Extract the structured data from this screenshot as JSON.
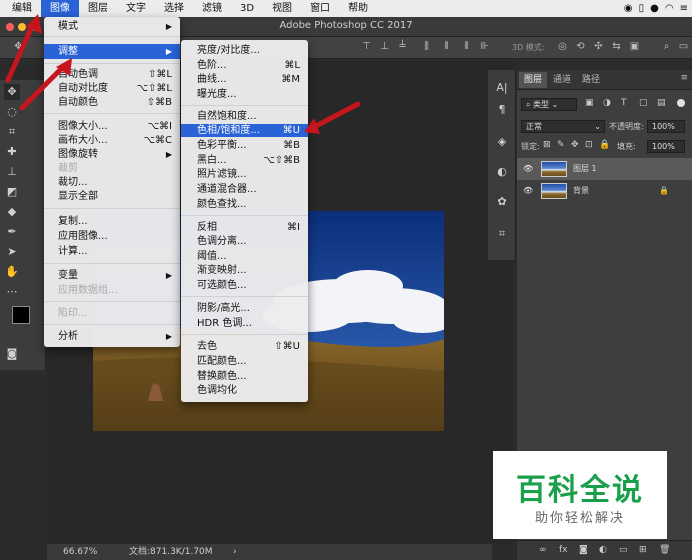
{
  "menubar": {
    "items": [
      "编辑",
      "图像",
      "图层",
      "文字",
      "选择",
      "滤镜",
      "3D",
      "视图",
      "窗口",
      "帮助"
    ],
    "active_index": 1
  },
  "window": {
    "title": "Adobe Photoshop CC 2017"
  },
  "options_bar": {
    "mode_label": "3D 模式:"
  },
  "image_menu": {
    "items": [
      {
        "label": "模式",
        "submenu": true
      },
      {
        "label": "调整",
        "submenu": true,
        "highlighted": true
      },
      {
        "label": "自动色调",
        "shortcut": "⇧⌘L"
      },
      {
        "label": "自动对比度",
        "shortcut": "⌥⇧⌘L"
      },
      {
        "label": "自动颜色",
        "shortcut": "⇧⌘B"
      },
      {
        "label": "图像大小...",
        "shortcut": "⌥⌘I"
      },
      {
        "label": "画布大小...",
        "shortcut": "⌥⌘C"
      },
      {
        "label": "图像旋转",
        "submenu": true
      },
      {
        "label": "裁剪",
        "disabled": true
      },
      {
        "label": "裁切..."
      },
      {
        "label": "显示全部"
      },
      {
        "label": "复制..."
      },
      {
        "label": "应用图像..."
      },
      {
        "label": "计算..."
      },
      {
        "label": "变量",
        "submenu": true
      },
      {
        "label": "应用数据组...",
        "disabled": true
      },
      {
        "label": "陷印...",
        "disabled": true
      },
      {
        "label": "分析",
        "submenu": true
      }
    ]
  },
  "adjust_submenu": {
    "items": [
      {
        "label": "亮度/对比度..."
      },
      {
        "label": "色阶...",
        "shortcut": "⌘L"
      },
      {
        "label": "曲线...",
        "shortcut": "⌘M"
      },
      {
        "label": "曝光度..."
      },
      {
        "label": "自然饱和度..."
      },
      {
        "label": "色相/饱和度...",
        "shortcut": "⌘U",
        "highlighted": true
      },
      {
        "label": "色彩平衡...",
        "shortcut": "⌘B"
      },
      {
        "label": "黑白...",
        "shortcut": "⌥⇧⌘B"
      },
      {
        "label": "照片滤镜..."
      },
      {
        "label": "通道混合器..."
      },
      {
        "label": "颜色查找..."
      },
      {
        "label": "反相",
        "shortcut": "⌘I"
      },
      {
        "label": "色调分离..."
      },
      {
        "label": "阈值..."
      },
      {
        "label": "渐变映射..."
      },
      {
        "label": "可选颜色..."
      },
      {
        "label": "阴影/高光..."
      },
      {
        "label": "HDR 色调..."
      },
      {
        "label": "去色",
        "shortcut": "⇧⌘U"
      },
      {
        "label": "匹配颜色..."
      },
      {
        "label": "替换颜色..."
      },
      {
        "label": "色调均化"
      }
    ]
  },
  "layers_panel": {
    "tabs": [
      "图层",
      "通道",
      "路径"
    ],
    "filter_kind": "类型",
    "blend_mode": "正常",
    "opacity_label": "不透明度:",
    "opacity_value": "100%",
    "lock_label": "锁定:",
    "fill_label": "填充:",
    "fill_value": "100%",
    "layers": [
      {
        "name": "图层 1",
        "selected": true
      },
      {
        "name": "背景",
        "locked": true
      }
    ]
  },
  "status": {
    "zoom": "66.67%",
    "doc_info": "文档:871.3K/1.70M"
  },
  "watermark": {
    "title": "百科全说",
    "subtitle": "助你轻松解决"
  },
  "colors": {
    "menu_highlight": "#2a63d6",
    "arrow_red": "#c4161c",
    "watermark_green": "#1aa04a"
  }
}
